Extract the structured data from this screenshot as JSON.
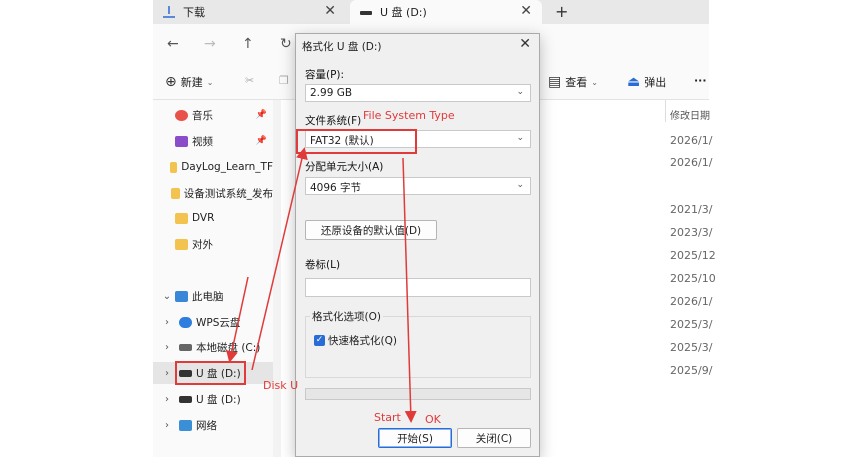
{
  "tabs": [
    {
      "label": "下载",
      "icon": "download-icon"
    },
    {
      "label": "U 盘 (D:)",
      "icon": "drive-icon"
    }
  ],
  "toolbar": {
    "new_label": "新建",
    "view_label": "查看",
    "eject_label": "弹出",
    "more_label": "···"
  },
  "sidebar": {
    "items": [
      {
        "label": "音乐",
        "icon": "music-icon",
        "pinned": true
      },
      {
        "label": "视频",
        "icon": "video-icon",
        "pinned": true
      },
      {
        "label": "DayLog_Learn_TF",
        "icon": "folder-icon"
      },
      {
        "label": "设备测试系统_发布",
        "icon": "folder-icon"
      },
      {
        "label": "DVR",
        "icon": "folder-icon"
      },
      {
        "label": "对外",
        "icon": "folder-icon"
      },
      {
        "label": "此电脑",
        "icon": "pc-icon"
      },
      {
        "label": "WPS云盘",
        "icon": "cloud-icon"
      },
      {
        "label": "本地磁盘 (C:)",
        "icon": "disk-icon"
      },
      {
        "label": "U 盘 (D:)",
        "icon": "usb-drive-icon"
      },
      {
        "label": "U 盘 (D:)",
        "icon": "usb-drive-icon"
      },
      {
        "label": "网络",
        "icon": "network-icon"
      }
    ]
  },
  "content": {
    "date_header": "修改日期",
    "dates": [
      "2026/1/",
      "2026/1/",
      "2021/3/",
      "2023/3/",
      "2025/12",
      "2025/10",
      "2026/1/",
      "2025/3/",
      "2025/3/",
      "2025/9/"
    ]
  },
  "dialog": {
    "title": "格式化 U 盘 (D:)",
    "capacity_label": "容量(P):",
    "capacity_value": "2.99 GB",
    "fs_label": "文件系统(F)",
    "fs_value": "FAT32 (默认)",
    "alloc_label": "分配单元大小(A)",
    "alloc_value": "4096 字节",
    "restore_label": "还原设备的默认值(D)",
    "volume_label": "卷标(L)",
    "volume_value": "",
    "options_label": "格式化选项(O)",
    "quick_format_label": "快速格式化(Q)",
    "quick_format_checked": true,
    "start_label": "开始(S)",
    "close_label": "关闭(C)"
  },
  "annotations": {
    "fs_type": "File System Type",
    "disk_u": "Disk U",
    "start": "Start",
    "ok": "OK",
    "color": "#e03a3a"
  }
}
